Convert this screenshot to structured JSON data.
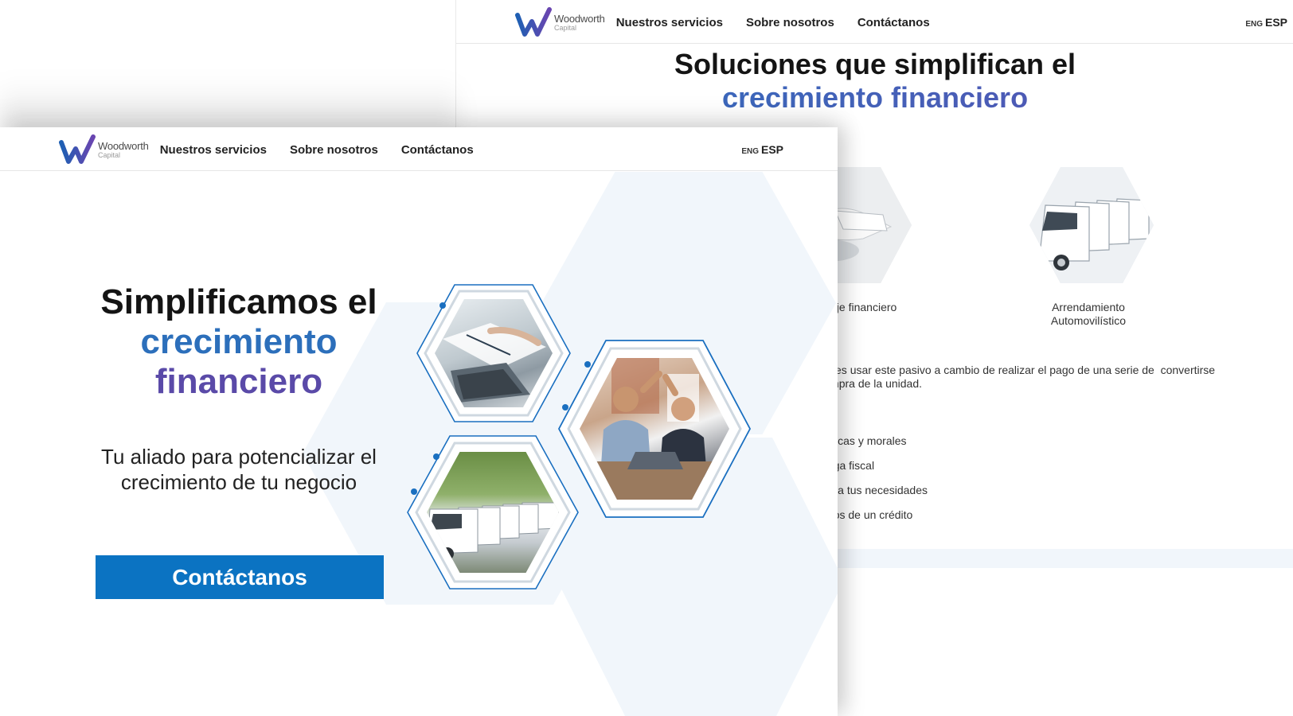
{
  "colors": {
    "brand_blue": "#0b73c2",
    "brand_purple": "#5a4aa8",
    "bg_hex": "#f1f6fb"
  },
  "brand": {
    "name": "Woodworth",
    "sub": "Capital"
  },
  "nav": {
    "items": [
      "Nuestros servicios",
      "Sobre nosotros",
      "Contáctanos"
    ],
    "lang_eng": "ENG",
    "lang_esp": "ESP"
  },
  "back_page": {
    "title_line1": "Soluciones que simplifican el",
    "title_line2": "crecimiento financiero",
    "services": [
      {
        "label": "ctoraje financiero",
        "image": "handshake-documents"
      },
      {
        "label": "Arrendamiento Automovilístico",
        "image": "white-vans"
      }
    ],
    "description": "ros clientes usar este pasivo a cambio de realizar el pago de una serie de  convertirse en la compra de la unidad.",
    "bullets": [
      "sonas físicas y morales",
      "duce carga fiscal",
      "le plazos a tus necesidades",
      "nores a los de un crédito"
    ]
  },
  "front_page": {
    "hero_title_line1": "Simplificamos el",
    "hero_title_line2": "crecimiento",
    "hero_title_line3": "financiero",
    "hero_subtitle": "Tu aliado para potencializar el crecimiento de tu negocio",
    "cta_label": "Contáctanos",
    "photos": [
      {
        "subject": "laptop-paperwork"
      },
      {
        "subject": "colleagues-high-five"
      },
      {
        "subject": "fleet-of-vans"
      }
    ]
  }
}
